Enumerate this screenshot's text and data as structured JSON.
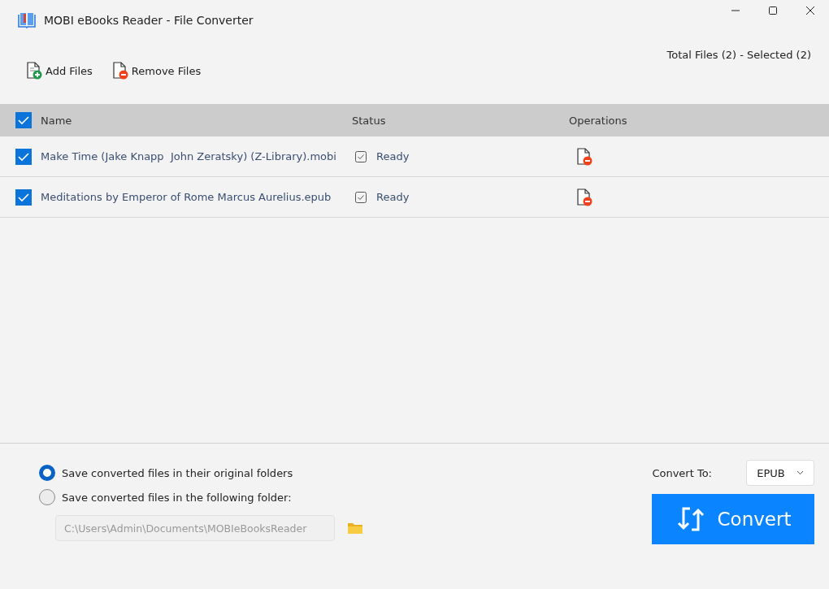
{
  "window": {
    "title": "MOBI eBooks Reader - File Converter"
  },
  "toolbar": {
    "buttons": [
      {
        "kind": "add",
        "label": "Add Files"
      },
      {
        "kind": "remove",
        "label": "Remove Files"
      }
    ],
    "summary": "Total Files (2) - Selected (2)"
  },
  "table": {
    "select_all": {
      "checked": true
    },
    "columns": [
      "Name",
      "Status",
      "Operations"
    ],
    "rows": [
      {
        "checked": true,
        "name": "Make Time (Jake Knapp  John Zeratsky) (Z-Library).mobi",
        "status": "Ready"
      },
      {
        "checked": true,
        "name": "Meditations by Emperor of Rome Marcus Aurelius.epub",
        "status": "Ready"
      }
    ]
  },
  "output": {
    "options": [
      {
        "label": "Save converted files in their original folders",
        "selected": true
      },
      {
        "label": "Save converted files in the following folder:",
        "selected": false
      }
    ],
    "folder_path": {
      "value": "C:\\Users\\Admin\\Documents\\MOBIeBooksReader",
      "disabled": true
    }
  },
  "convert": {
    "label": "Convert To:",
    "format": "EPUB",
    "button": "Convert"
  }
}
